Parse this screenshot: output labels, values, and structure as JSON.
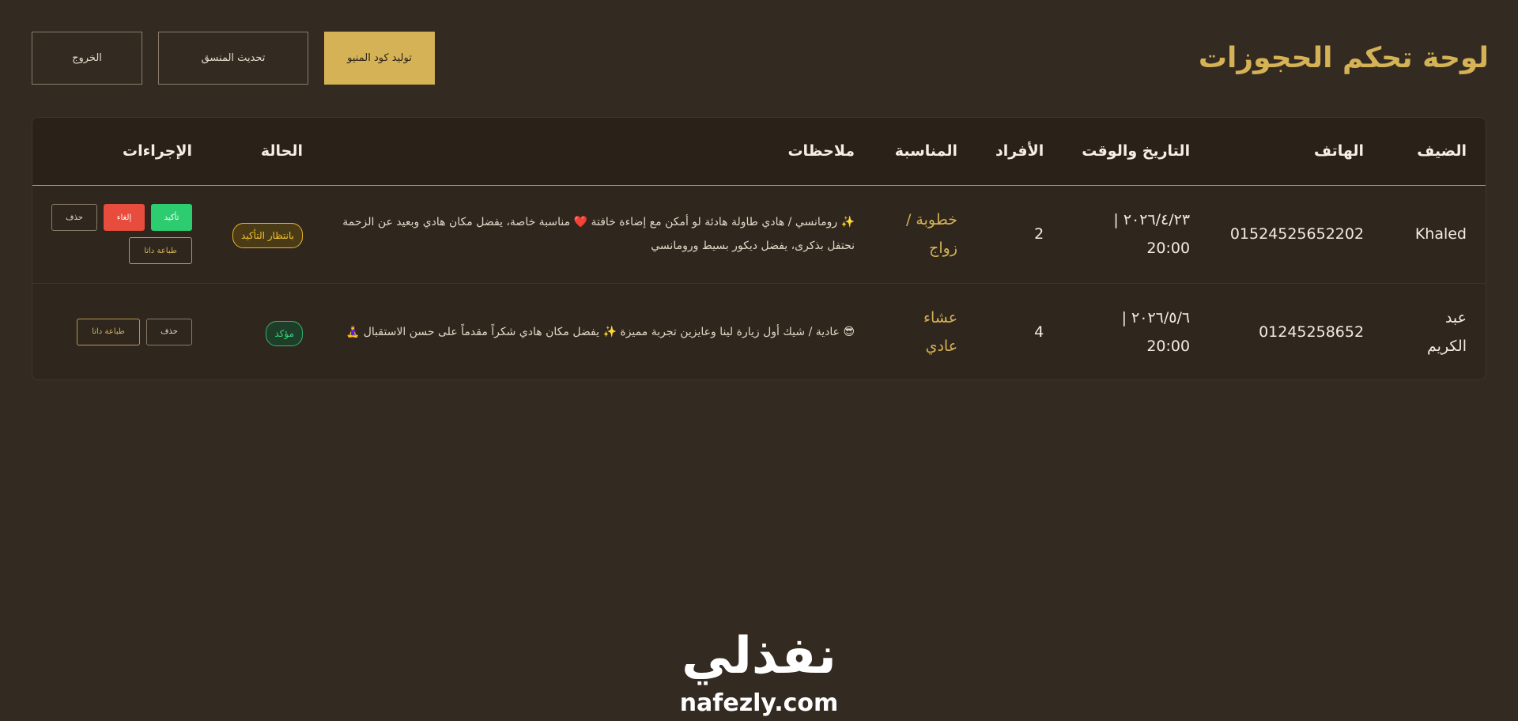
{
  "header": {
    "title": "لوحة تحكم الحجوزات",
    "generate_menu_code": "توليد كود المنيو",
    "update_coordinator": "تحديث المنسق",
    "logout": "الخروج"
  },
  "table": {
    "columns": {
      "guest": "الضيف",
      "phone": "الهاتف",
      "datetime": "التاريخ والوقت",
      "count": "الأفراد",
      "occasion": "المناسبة",
      "notes": "ملاحظات",
      "status": "الحالة",
      "actions": "الإجراءات"
    },
    "rows": [
      {
        "guest": "Khaled",
        "phone": "01524525652202",
        "datetime": "٢٠٢٦/٤/٢٣ | 20:00",
        "count": "2",
        "occasion": "خطوبة / زواج",
        "notes": "✨ رومانسي / هادي طاولة هادئة لو أمكن مع إضاءة خافتة ❤️ مناسبة خاصة، يفضل مكان هادي وبعيد عن الزحمة نحتفل بذكرى، يفضل ديكور بسيط ورومانسي",
        "status": "بانتظار التأكيد",
        "actions": {
          "confirm": "تأكيد",
          "cancel": "إلغاء",
          "delete": "حذف",
          "print": "طباعة داتا"
        }
      },
      {
        "guest": "عبد الكريم",
        "phone": "01245258652",
        "datetime": "٢٠٢٦/٥/٦ | 20:00",
        "count": "4",
        "occasion": "عشاء عادي",
        "notes": "😎 عادية / شيك أول زيارة لينا وعايزين تجربة مميزة ✨ يفضل مكان هادي شكراً مقدماً على حسن الاستقبال 🧘‍♀️",
        "status": "مؤكد",
        "actions": {
          "delete": "حذف",
          "print": "طباعة داتا"
        }
      }
    ]
  },
  "watermark": {
    "logo": "نفذلي",
    "url": "nafezly.com"
  },
  "colors": {
    "background": "#332a21",
    "accent_gold": "#d4b255",
    "confirm_green": "#2ecc71",
    "cancel_red": "#e74c3c",
    "pending_yellow": "#f0c330"
  }
}
